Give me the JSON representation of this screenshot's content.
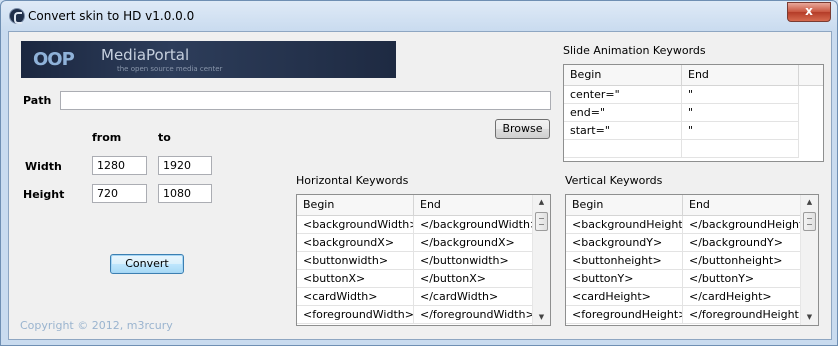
{
  "window": {
    "title": "Convert skin to HD v1.0.0.0",
    "close_label": "x"
  },
  "logo": {
    "name": "MediaPortal",
    "tagline": "the open source media center"
  },
  "path": {
    "label": "Path",
    "value": "",
    "browse_label": "Browse"
  },
  "resolution": {
    "from_label": "from",
    "to_label": "to",
    "width_label": "Width",
    "height_label": "Height",
    "width_from": "1280",
    "width_to": "1920",
    "height_from": "720",
    "height_to": "1080"
  },
  "convert_label": "Convert",
  "copyright": "Copyright © 2012, m3rcury",
  "slide": {
    "title": "Slide Animation Keywords",
    "headers": [
      "Begin",
      "End"
    ],
    "rows": [
      [
        "center=\"",
        "\""
      ],
      [
        "end=\"",
        "\""
      ],
      [
        "start=\"",
        "\""
      ]
    ]
  },
  "horizontal": {
    "title": "Horizontal Keywords",
    "headers": [
      "Begin",
      "End"
    ],
    "rows": [
      [
        "<backgroundWidth>",
        "</backgroundWidth>"
      ],
      [
        "<backgroundX>",
        "</backgroundX>"
      ],
      [
        "<buttonwidth>",
        "</buttonwidth>"
      ],
      [
        "<buttonX>",
        "</buttonX>"
      ],
      [
        "<cardWidth>",
        "</cardWidth>"
      ],
      [
        "<foregroundWidth>",
        "</foregroundWidth>"
      ]
    ]
  },
  "vertical": {
    "title": "Vertical Keywords",
    "headers": [
      "Begin",
      "End"
    ],
    "rows": [
      [
        "<backgroundHeight>",
        "</backgroundHeight>"
      ],
      [
        "<backgroundY>",
        "</backgroundY>"
      ],
      [
        "<buttonheight>",
        "</buttonheight>"
      ],
      [
        "<buttonY>",
        "</buttonY>"
      ],
      [
        "<cardHeight>",
        "</cardHeight>"
      ],
      [
        "<foregroundHeight>",
        "</foregroundHeight>"
      ]
    ]
  }
}
